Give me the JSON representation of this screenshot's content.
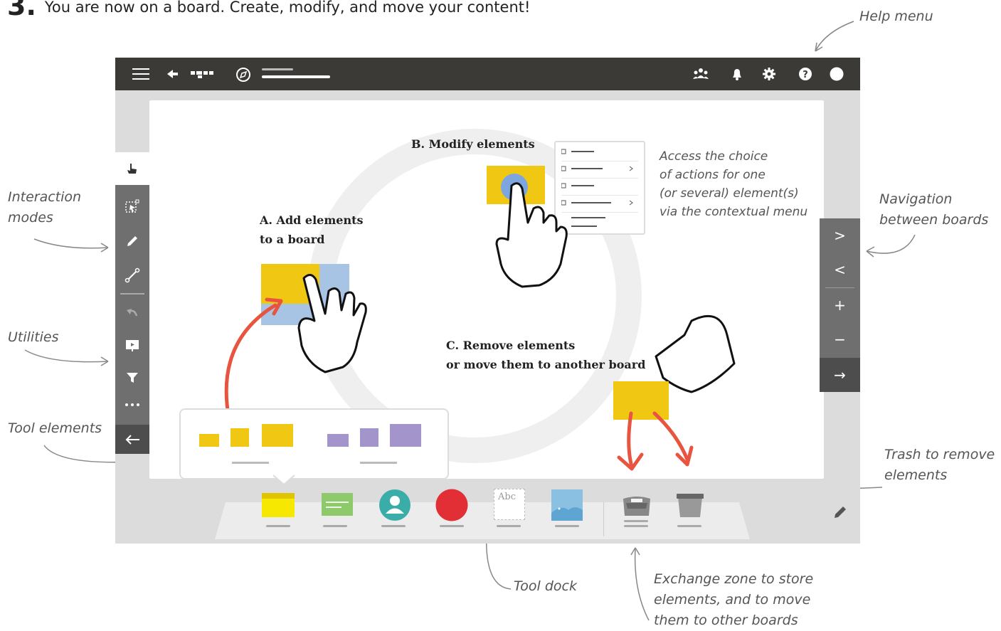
{
  "header": {
    "number": "3.",
    "text": "You are now on a board. Create, modify, and move your content!"
  },
  "annotations": {
    "help_menu": "Help menu",
    "interaction_modes": [
      "Interaction",
      "modes"
    ],
    "utilities": "Utilities",
    "tool_elements": "Tool elements",
    "navigation": [
      "Navigation",
      "between boards"
    ],
    "trash": [
      "Trash to remove",
      "elements"
    ],
    "tool_dock": "Tool dock",
    "exchange_zone": [
      "Exchange zone to store",
      "elements, and to move",
      "them to other boards"
    ],
    "context_menu": [
      "Access the choice",
      "of actions for one",
      "(or several) element(s)",
      "via the contextual menu"
    ]
  },
  "board_labels": {
    "add": [
      "A. Add elements",
      "to a board"
    ],
    "modify": "B. Modify elements",
    "remove": [
      "C. Remove elements",
      "or move them to another board"
    ]
  },
  "topbar_icons": [
    "menu-icon",
    "back-arrow-icon",
    "boards-icon",
    "compass-icon",
    "people-icon",
    "bell-icon",
    "gear-icon",
    "help-icon",
    "avatar-icon"
  ],
  "left_toolbar": {
    "interaction_modes": [
      "hand-icon",
      "select-icon",
      "pen-icon",
      "connector-icon"
    ],
    "utilities": [
      "undo-icon",
      "presentation-icon",
      "filter-icon",
      "more-icon"
    ],
    "collapse_icon": "arrow-left-icon"
  },
  "right_nav": {
    "next": ">",
    "prev": "<",
    "zoom_in": "+",
    "zoom_out": "−",
    "exit": "→"
  },
  "dock": {
    "text_tile_label": "Abc",
    "items": [
      "sticky-note-icon",
      "card-icon",
      "user-icon",
      "circle-icon",
      "text-icon",
      "image-icon",
      "exchange-icon",
      "trash-icon"
    ]
  },
  "colors": {
    "topbar": "#3c3a37",
    "toolbar": "#6f6f6f",
    "frame": "#dcdcdc",
    "yellow": "#f0c814",
    "purple": "#a394cc",
    "red_arrow": "#e8543f"
  }
}
